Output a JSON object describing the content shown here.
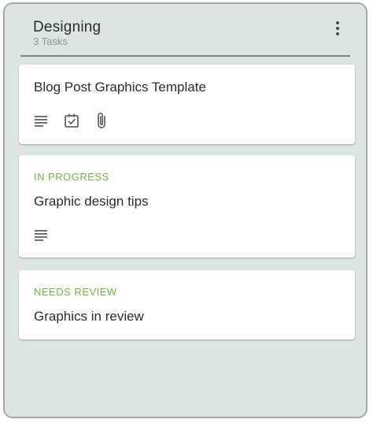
{
  "column": {
    "title": "Designing",
    "task_count": "3 Tasks",
    "menu_icon": "more-vertical-icon"
  },
  "cards": [
    {
      "status": "",
      "title": "Blog Post Graphics Template",
      "icons": [
        "description-icon",
        "checklist-icon",
        "attachment-icon"
      ]
    },
    {
      "status": "IN PROGRESS",
      "title": "Graphic design tips",
      "icons": [
        "description-icon"
      ]
    },
    {
      "status": "NEEDS REVIEW",
      "title": "Graphics in review",
      "icons": []
    }
  ],
  "colors": {
    "column_bg": "#dde5e1",
    "status_green": "#6db33f",
    "text_dark": "#2a2d2b"
  }
}
